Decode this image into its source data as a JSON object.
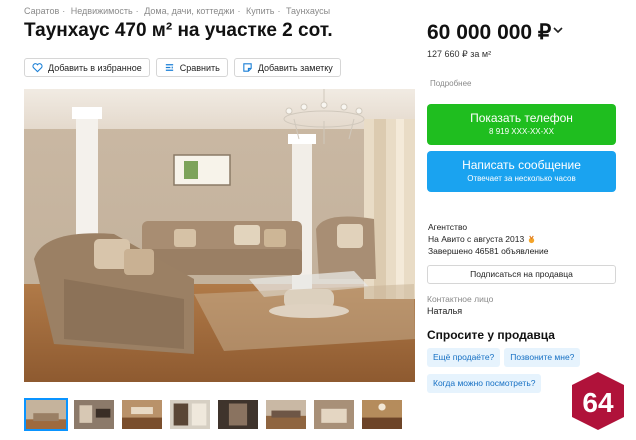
{
  "breadcrumbs": [
    "Саратов",
    "Недвижимость",
    "Дома, дачи, коттеджи",
    "Купить",
    "Таунхаусы"
  ],
  "breadcrumb_separator": "·",
  "title": "Таунхаус 470 м² на участке 2 сот.",
  "actions": {
    "favorite": "Добавить в избранное",
    "compare": "Сравнить",
    "note": "Добавить заметку"
  },
  "price": {
    "value": "60 000 000 ₽",
    "per_m2": "127 660 ₽ за м²",
    "details_link": "Подробнее"
  },
  "phone_button": {
    "label": "Показать телефон",
    "number": "8 919 XXX-XX-XX",
    "color": "#1fbe1f"
  },
  "message_button": {
    "label": "Написать сообщение",
    "sub": "Отвечает за несколько часов",
    "color": "#1aa3f0"
  },
  "seller": {
    "type": "Агентство",
    "since": "На Авито с августа 2013",
    "completed": "Завершено 46581 объявление",
    "subscribe": "Подписаться на продавца",
    "contact_label": "Контактное лицо",
    "contact_name": "Наталья"
  },
  "ask": {
    "title": "Спросите у продавца",
    "questions": [
      "Ещё продаёте?",
      "Позвоните мне?",
      "Когда можно посмотреть?"
    ]
  },
  "logo": {
    "text": "64",
    "color": "#b0123a"
  },
  "thumbnails_count": 8
}
